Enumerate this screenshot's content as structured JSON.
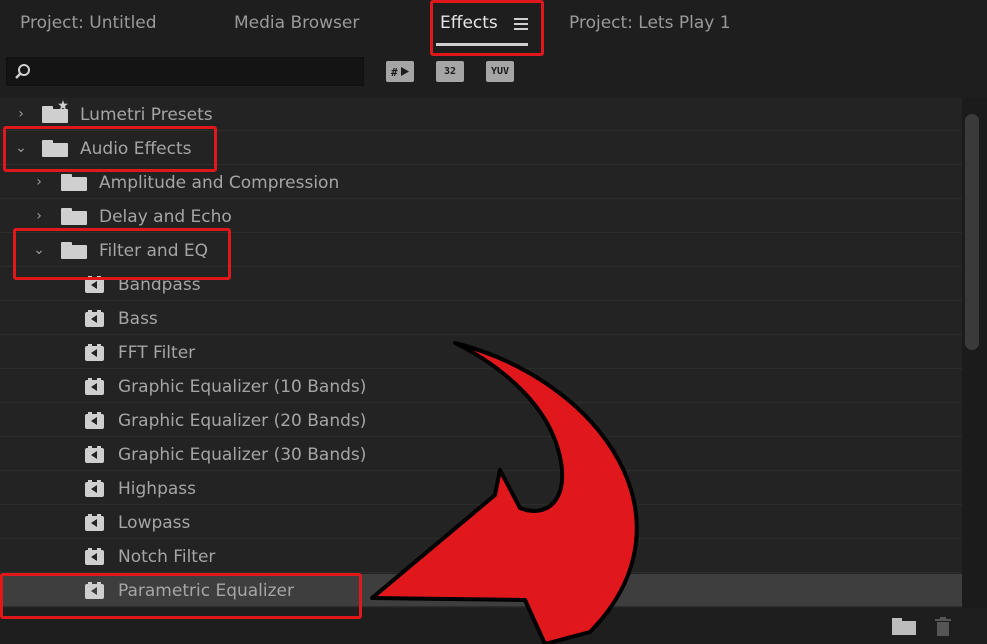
{
  "tabs": [
    {
      "label": "Project: Untitled",
      "active": false
    },
    {
      "label": "Media Browser",
      "active": false
    },
    {
      "label": "Effects",
      "active": true
    },
    {
      "label": "Project: Lets Play 1",
      "active": false
    }
  ],
  "search": {
    "value": "",
    "placeholder": ""
  },
  "toolbar": {
    "accelerated_label": "",
    "bit32_label": "32",
    "yuv_label": "YUV"
  },
  "tree": [
    {
      "label": "Lumetri Presets",
      "type": "folder",
      "level": 0,
      "expanded": false
    },
    {
      "label": "Audio Effects",
      "type": "folder",
      "level": 0,
      "expanded": true
    },
    {
      "label": "Amplitude and Compression",
      "type": "folder",
      "level": 1,
      "expanded": false
    },
    {
      "label": "Delay and Echo",
      "type": "folder",
      "level": 1,
      "expanded": false
    },
    {
      "label": "Filter and EQ",
      "type": "folder",
      "level": 1,
      "expanded": true
    },
    {
      "label": "Bandpass",
      "type": "effect",
      "level": 2
    },
    {
      "label": "Bass",
      "type": "effect",
      "level": 2
    },
    {
      "label": "FFT Filter",
      "type": "effect",
      "level": 2
    },
    {
      "label": "Graphic Equalizer (10 Bands)",
      "type": "effect",
      "level": 2
    },
    {
      "label": "Graphic Equalizer (20 Bands)",
      "type": "effect",
      "level": 2
    },
    {
      "label": "Graphic Equalizer (30 Bands)",
      "type": "effect",
      "level": 2
    },
    {
      "label": "Highpass",
      "type": "effect",
      "level": 2
    },
    {
      "label": "Lowpass",
      "type": "effect",
      "level": 2
    },
    {
      "label": "Notch Filter",
      "type": "effect",
      "level": 2
    },
    {
      "label": "Parametric Equalizer",
      "type": "effect",
      "level": 2,
      "selected": true
    }
  ],
  "colors": {
    "annotation": "#e0181c",
    "panel": "#232323",
    "selected_row": "#3e3e3e"
  }
}
